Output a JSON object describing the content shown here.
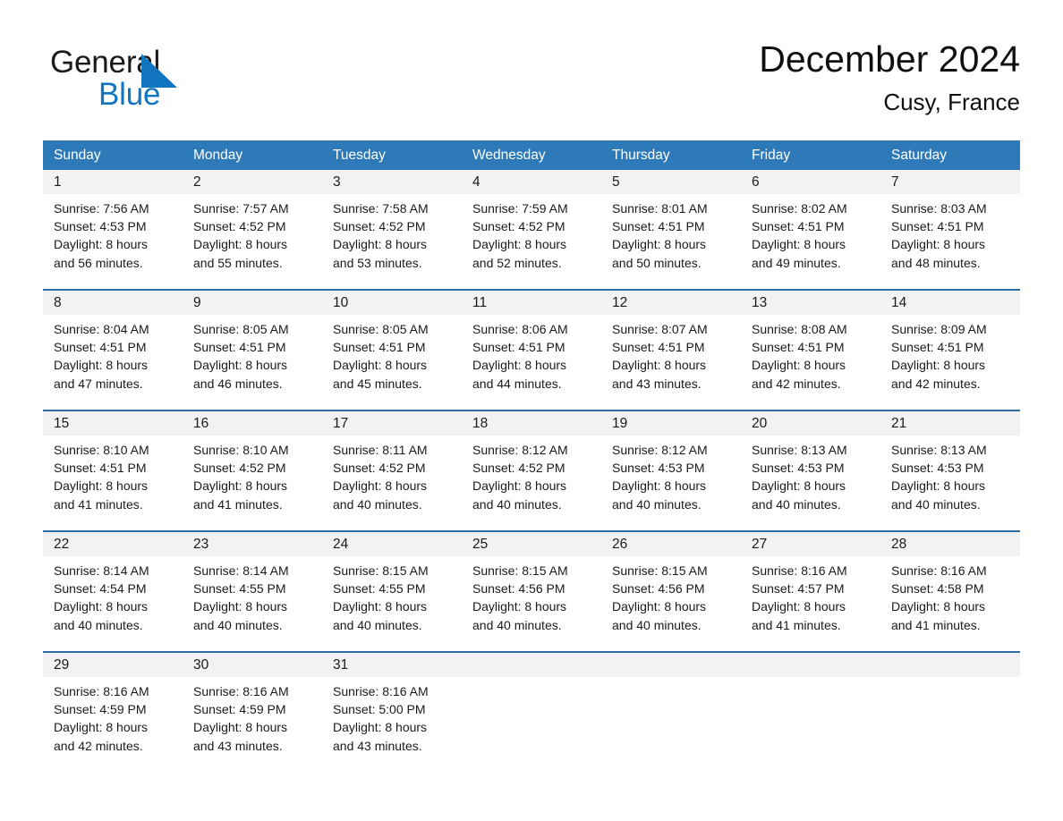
{
  "brand": {
    "name_part1": "General",
    "name_part2": "Blue",
    "triangle_color": "#1175c0",
    "logo_icon": "general-blue-logo-icon"
  },
  "header": {
    "title": "December 2024",
    "location": "Cusy, France"
  },
  "theme": {
    "header_blue": "#2e7ab8",
    "row_divider_blue": "#2e6da4",
    "daynum_band": "#f2f2f2",
    "text": "#1a1a1a"
  },
  "calendar": {
    "weekdays": [
      "Sunday",
      "Monday",
      "Tuesday",
      "Wednesday",
      "Thursday",
      "Friday",
      "Saturday"
    ],
    "weeks": [
      [
        {
          "day": "1",
          "sunrise": "Sunrise: 7:56 AM",
          "sunset": "Sunset: 4:53 PM",
          "daylight_1": "Daylight: 8 hours",
          "daylight_2": "and 56 minutes."
        },
        {
          "day": "2",
          "sunrise": "Sunrise: 7:57 AM",
          "sunset": "Sunset: 4:52 PM",
          "daylight_1": "Daylight: 8 hours",
          "daylight_2": "and 55 minutes."
        },
        {
          "day": "3",
          "sunrise": "Sunrise: 7:58 AM",
          "sunset": "Sunset: 4:52 PM",
          "daylight_1": "Daylight: 8 hours",
          "daylight_2": "and 53 minutes."
        },
        {
          "day": "4",
          "sunrise": "Sunrise: 7:59 AM",
          "sunset": "Sunset: 4:52 PM",
          "daylight_1": "Daylight: 8 hours",
          "daylight_2": "and 52 minutes."
        },
        {
          "day": "5",
          "sunrise": "Sunrise: 8:01 AM",
          "sunset": "Sunset: 4:51 PM",
          "daylight_1": "Daylight: 8 hours",
          "daylight_2": "and 50 minutes."
        },
        {
          "day": "6",
          "sunrise": "Sunrise: 8:02 AM",
          "sunset": "Sunset: 4:51 PM",
          "daylight_1": "Daylight: 8 hours",
          "daylight_2": "and 49 minutes."
        },
        {
          "day": "7",
          "sunrise": "Sunrise: 8:03 AM",
          "sunset": "Sunset: 4:51 PM",
          "daylight_1": "Daylight: 8 hours",
          "daylight_2": "and 48 minutes."
        }
      ],
      [
        {
          "day": "8",
          "sunrise": "Sunrise: 8:04 AM",
          "sunset": "Sunset: 4:51 PM",
          "daylight_1": "Daylight: 8 hours",
          "daylight_2": "and 47 minutes."
        },
        {
          "day": "9",
          "sunrise": "Sunrise: 8:05 AM",
          "sunset": "Sunset: 4:51 PM",
          "daylight_1": "Daylight: 8 hours",
          "daylight_2": "and 46 minutes."
        },
        {
          "day": "10",
          "sunrise": "Sunrise: 8:05 AM",
          "sunset": "Sunset: 4:51 PM",
          "daylight_1": "Daylight: 8 hours",
          "daylight_2": "and 45 minutes."
        },
        {
          "day": "11",
          "sunrise": "Sunrise: 8:06 AM",
          "sunset": "Sunset: 4:51 PM",
          "daylight_1": "Daylight: 8 hours",
          "daylight_2": "and 44 minutes."
        },
        {
          "day": "12",
          "sunrise": "Sunrise: 8:07 AM",
          "sunset": "Sunset: 4:51 PM",
          "daylight_1": "Daylight: 8 hours",
          "daylight_2": "and 43 minutes."
        },
        {
          "day": "13",
          "sunrise": "Sunrise: 8:08 AM",
          "sunset": "Sunset: 4:51 PM",
          "daylight_1": "Daylight: 8 hours",
          "daylight_2": "and 42 minutes."
        },
        {
          "day": "14",
          "sunrise": "Sunrise: 8:09 AM",
          "sunset": "Sunset: 4:51 PM",
          "daylight_1": "Daylight: 8 hours",
          "daylight_2": "and 42 minutes."
        }
      ],
      [
        {
          "day": "15",
          "sunrise": "Sunrise: 8:10 AM",
          "sunset": "Sunset: 4:51 PM",
          "daylight_1": "Daylight: 8 hours",
          "daylight_2": "and 41 minutes."
        },
        {
          "day": "16",
          "sunrise": "Sunrise: 8:10 AM",
          "sunset": "Sunset: 4:52 PM",
          "daylight_1": "Daylight: 8 hours",
          "daylight_2": "and 41 minutes."
        },
        {
          "day": "17",
          "sunrise": "Sunrise: 8:11 AM",
          "sunset": "Sunset: 4:52 PM",
          "daylight_1": "Daylight: 8 hours",
          "daylight_2": "and 40 minutes."
        },
        {
          "day": "18",
          "sunrise": "Sunrise: 8:12 AM",
          "sunset": "Sunset: 4:52 PM",
          "daylight_1": "Daylight: 8 hours",
          "daylight_2": "and 40 minutes."
        },
        {
          "day": "19",
          "sunrise": "Sunrise: 8:12 AM",
          "sunset": "Sunset: 4:53 PM",
          "daylight_1": "Daylight: 8 hours",
          "daylight_2": "and 40 minutes."
        },
        {
          "day": "20",
          "sunrise": "Sunrise: 8:13 AM",
          "sunset": "Sunset: 4:53 PM",
          "daylight_1": "Daylight: 8 hours",
          "daylight_2": "and 40 minutes."
        },
        {
          "day": "21",
          "sunrise": "Sunrise: 8:13 AM",
          "sunset": "Sunset: 4:53 PM",
          "daylight_1": "Daylight: 8 hours",
          "daylight_2": "and 40 minutes."
        }
      ],
      [
        {
          "day": "22",
          "sunrise": "Sunrise: 8:14 AM",
          "sunset": "Sunset: 4:54 PM",
          "daylight_1": "Daylight: 8 hours",
          "daylight_2": "and 40 minutes."
        },
        {
          "day": "23",
          "sunrise": "Sunrise: 8:14 AM",
          "sunset": "Sunset: 4:55 PM",
          "daylight_1": "Daylight: 8 hours",
          "daylight_2": "and 40 minutes."
        },
        {
          "day": "24",
          "sunrise": "Sunrise: 8:15 AM",
          "sunset": "Sunset: 4:55 PM",
          "daylight_1": "Daylight: 8 hours",
          "daylight_2": "and 40 minutes."
        },
        {
          "day": "25",
          "sunrise": "Sunrise: 8:15 AM",
          "sunset": "Sunset: 4:56 PM",
          "daylight_1": "Daylight: 8 hours",
          "daylight_2": "and 40 minutes."
        },
        {
          "day": "26",
          "sunrise": "Sunrise: 8:15 AM",
          "sunset": "Sunset: 4:56 PM",
          "daylight_1": "Daylight: 8 hours",
          "daylight_2": "and 40 minutes."
        },
        {
          "day": "27",
          "sunrise": "Sunrise: 8:16 AM",
          "sunset": "Sunset: 4:57 PM",
          "daylight_1": "Daylight: 8 hours",
          "daylight_2": "and 41 minutes."
        },
        {
          "day": "28",
          "sunrise": "Sunrise: 8:16 AM",
          "sunset": "Sunset: 4:58 PM",
          "daylight_1": "Daylight: 8 hours",
          "daylight_2": "and 41 minutes."
        }
      ],
      [
        {
          "day": "29",
          "sunrise": "Sunrise: 8:16 AM",
          "sunset": "Sunset: 4:59 PM",
          "daylight_1": "Daylight: 8 hours",
          "daylight_2": "and 42 minutes."
        },
        {
          "day": "30",
          "sunrise": "Sunrise: 8:16 AM",
          "sunset": "Sunset: 4:59 PM",
          "daylight_1": "Daylight: 8 hours",
          "daylight_2": "and 43 minutes."
        },
        {
          "day": "31",
          "sunrise": "Sunrise: 8:16 AM",
          "sunset": "Sunset: 5:00 PM",
          "daylight_1": "Daylight: 8 hours",
          "daylight_2": "and 43 minutes."
        },
        {
          "day": "",
          "sunrise": "",
          "sunset": "",
          "daylight_1": "",
          "daylight_2": ""
        },
        {
          "day": "",
          "sunrise": "",
          "sunset": "",
          "daylight_1": "",
          "daylight_2": ""
        },
        {
          "day": "",
          "sunrise": "",
          "sunset": "",
          "daylight_1": "",
          "daylight_2": ""
        },
        {
          "day": "",
          "sunrise": "",
          "sunset": "",
          "daylight_1": "",
          "daylight_2": ""
        }
      ]
    ]
  }
}
